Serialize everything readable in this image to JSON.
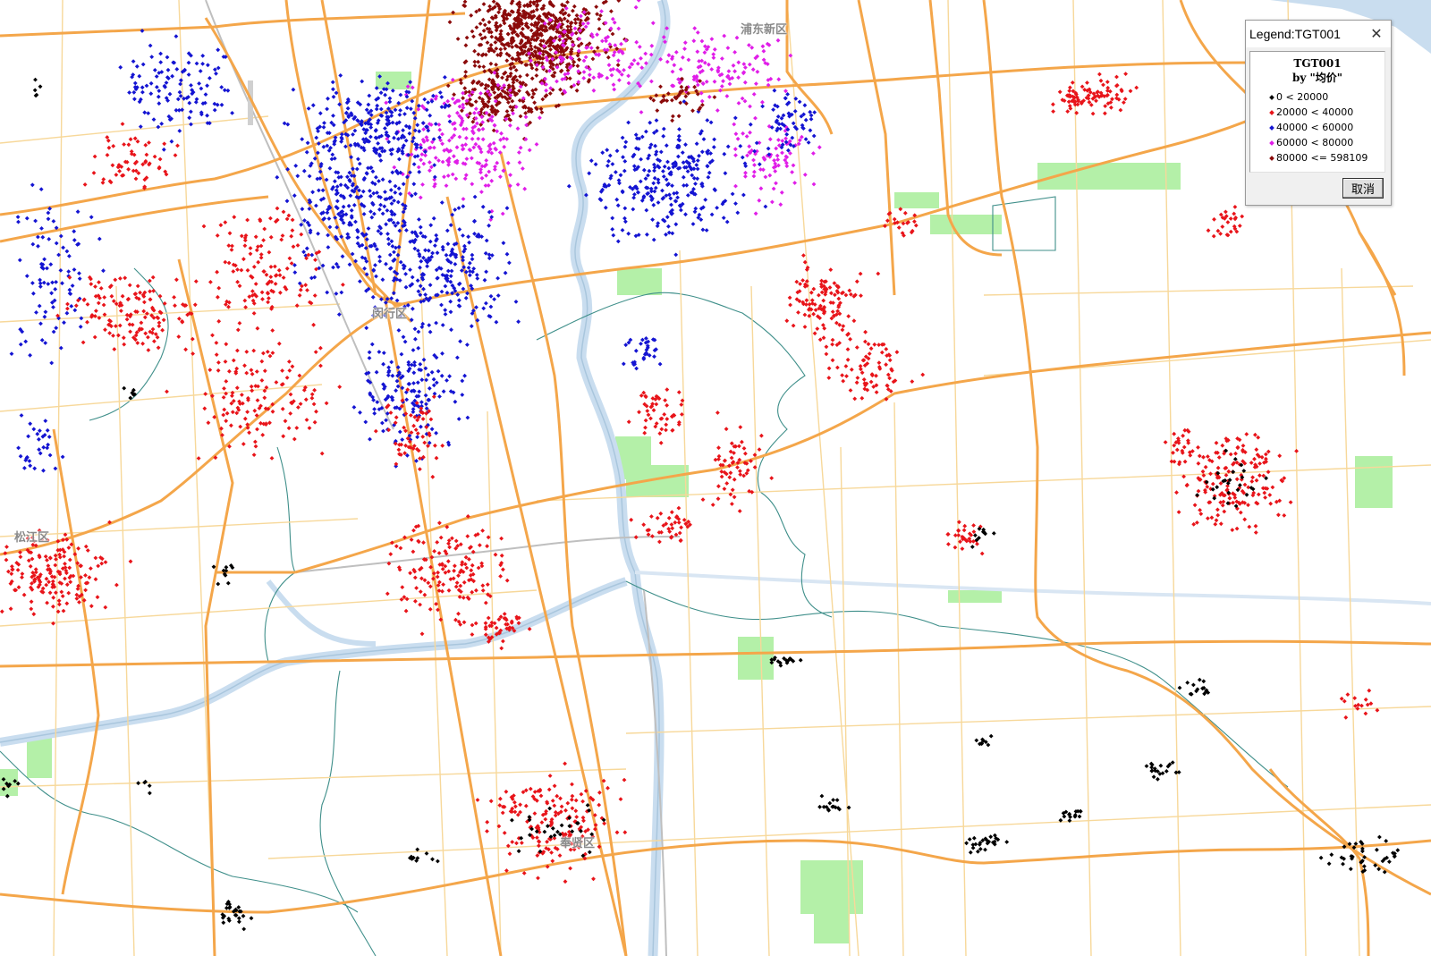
{
  "map": {
    "district_labels": [
      "浦东新区",
      "闵行区",
      "松江区",
      "奉贤区"
    ],
    "colors": {
      "water": "#c9ddef",
      "river_outline": "#a9c6dd",
      "green": "#b4f0a8",
      "major_road": "#f4a64a",
      "minor_road": "#f7d89a",
      "boundary": "#3f8f8a",
      "rail": "#bfbfbf"
    }
  },
  "legend": {
    "window_title": "Legend:TGT001",
    "close_icon": "close-icon",
    "heading": "TGT001",
    "subheading": "by \"均价\"",
    "items": [
      {
        "range": "0 < 20000",
        "color": "#000000"
      },
      {
        "range": "20000 < 40000",
        "color": "#e8141a"
      },
      {
        "range": "40000 < 60000",
        "color": "#1414d2"
      },
      {
        "range": "60000 < 80000",
        "color": "#e01ee8"
      },
      {
        "range": "80000 <= 598109",
        "color": "#8b0a0a"
      }
    ],
    "cancel_label": "取消"
  }
}
